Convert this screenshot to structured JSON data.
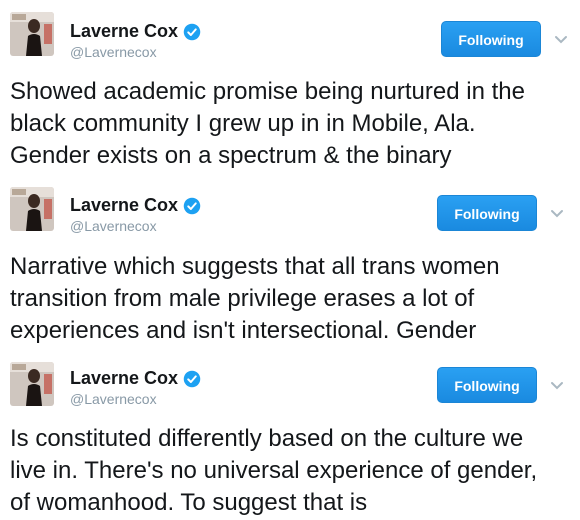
{
  "tweets": [
    {
      "name": "Laverne Cox",
      "handle": "@Lavernecox",
      "follow_label": "Following",
      "text_lines": [
        "Showed academic promise being nurtured in the",
        "black community I grew up in in Mobile, Ala.",
        "Gender exists on a spectrum & the binary"
      ],
      "icons": {
        "verified": "verified-badge-icon",
        "more": "chevron-down-icon"
      }
    },
    {
      "name": "Laverne Cox",
      "handle": "@Lavernecox",
      "follow_label": "Following",
      "text_lines": [
        "Narrative which suggests that all trans women",
        "transition from male privilege erases a lot of",
        "experiences and isn't intersectional. Gender"
      ],
      "icons": {
        "verified": "verified-badge-icon",
        "more": "chevron-down-icon"
      }
    },
    {
      "name": "Laverne Cox",
      "handle": "@Lavernecox",
      "follow_label": "Following",
      "text_lines": [
        "Is constituted differently based on the culture we",
        "live in. There's no universal experience of gender,",
        "of womanhood. To suggest that is"
      ],
      "icons": {
        "verified": "verified-badge-icon",
        "more": "chevron-down-icon"
      }
    }
  ],
  "colors": {
    "follow_button": "#1da1f2",
    "verified": "#1da1f2",
    "handle": "#8899a6",
    "text": "#14171a"
  }
}
